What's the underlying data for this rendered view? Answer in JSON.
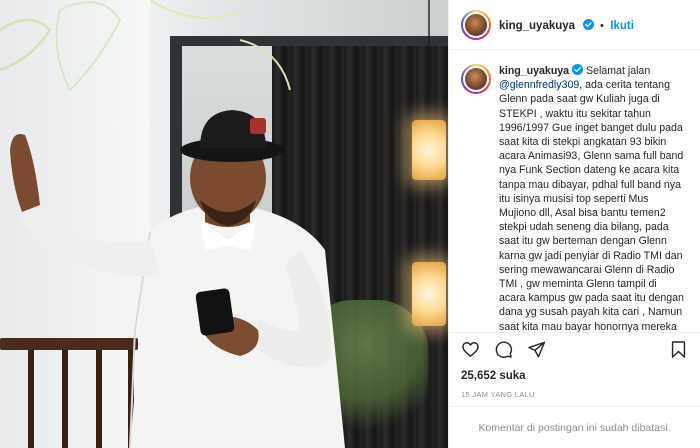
{
  "post": {
    "username": "king_uyakuya",
    "follow_label": "Ikuti",
    "dot": "•",
    "caption_username": "king_uyakuya",
    "caption_lead": "Selamat jalan",
    "caption_mention": "@glennfredly309",
    "caption_body": ", ada cerita tentang Glenn pada saat gw Kuliah juga di STEKPI , waktu itu sekitar tahun 1996/1997 Gue inget banget dulu pada saat kita di stekpi angkatan 93 bikin acara Animasi93, Glenn sama full band nya Funk Section dateng ke acara kita tanpa mau dibayar, pdhal full band nya itu isinya musisi top seperti Mus Mujiono dll, Asal bisa bantu temen2 stekpi udah seneng dia bilang, pada saat itu gw berteman dengan Glenn karna gw jadi penyiar di Radio TMI dan sering mewawancarai Glenn di Radio TMI , gw meminta Glenn tampil di acara kampus gw pada saat itu dengan dana yg susah payah kita cari , Namun saat kita mau bayar honornya mereka",
    "likes": "25,652 suka",
    "timestamp": "15 JAM YANG LALU",
    "comments_disabled": "Komentar di postingan ini sudah dibatasi."
  },
  "icons": {
    "verified": "verified-badge-icon",
    "like": "heart-icon",
    "comment": "comment-icon",
    "share": "share-icon",
    "save": "bookmark-icon"
  },
  "colors": {
    "link": "#0095f6",
    "mention": "#00376b",
    "muted": "#8e8e8e",
    "text": "#262626"
  }
}
